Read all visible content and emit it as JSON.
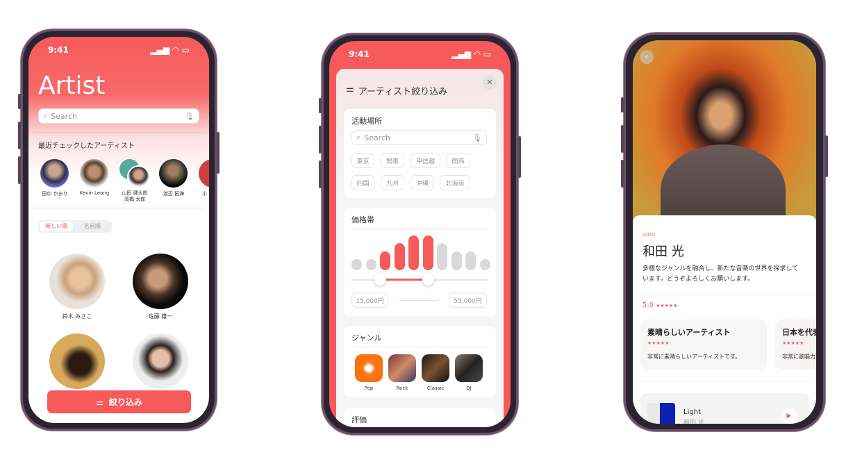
{
  "colors": {
    "accent": "#f75a5a",
    "inactive_bar": "#d9d9d9"
  },
  "status_time": "9:41",
  "screen1": {
    "title": "Artist",
    "search_placeholder": "Search",
    "recent_heading": "最近チェックしたアーティスト",
    "recent": [
      {
        "name": "田中 かおり"
      },
      {
        "name": "Kevin Leong"
      },
      {
        "name": "山田 健太郎\n高橋 太郎"
      },
      {
        "name": "渡辺 拓海"
      },
      {
        "name": "小"
      }
    ],
    "sort_tabs": [
      {
        "label": "新しい順",
        "active": true
      },
      {
        "label": "名前順",
        "active": false
      }
    ],
    "artists": [
      {
        "name": "鈴木 みさこ"
      },
      {
        "name": "佐藤 雄一"
      },
      {
        "name": ""
      },
      {
        "name": ""
      }
    ],
    "filter_button": "絞り込み"
  },
  "screen2": {
    "title": "アーティスト絞り込み",
    "close_icon": "close-icon",
    "location": {
      "heading": "活動場所",
      "search_placeholder": "Search",
      "chips": [
        "東京",
        "関東",
        "甲信越",
        "関西",
        "四国",
        "九州",
        "沖縄",
        "北海道"
      ]
    },
    "price": {
      "heading": "価格帯",
      "histogram": [
        1,
        1,
        2,
        3,
        4,
        4,
        3,
        2,
        2,
        1
      ],
      "selected_bins": [
        2,
        3,
        4,
        5
      ],
      "min_label": "15,000円",
      "max_label": "55,000円"
    },
    "genre": {
      "heading": "ジャンル",
      "items": [
        "Pop",
        "Rock",
        "Classic",
        "DJ"
      ]
    },
    "rating": {
      "heading": "評価"
    }
  },
  "screen3": {
    "category": "Artist",
    "name": "和田 光",
    "bio": "多様なジャンルを融合し、新たな音楽の世界を探求しています。どうぞよろしくお願いします。",
    "rating": "5.0",
    "stars": "★★★★★",
    "reviews": [
      {
        "title": "素晴らしいアーティスト",
        "stars": "★★★★★",
        "body": "非常に素晴らしいアーティストです。"
      },
      {
        "title": "日本を代表",
        "stars": "★★★★★",
        "body": "非常に歌唱力"
      }
    ],
    "track": {
      "title": "Light",
      "artist": "和田 光"
    }
  }
}
